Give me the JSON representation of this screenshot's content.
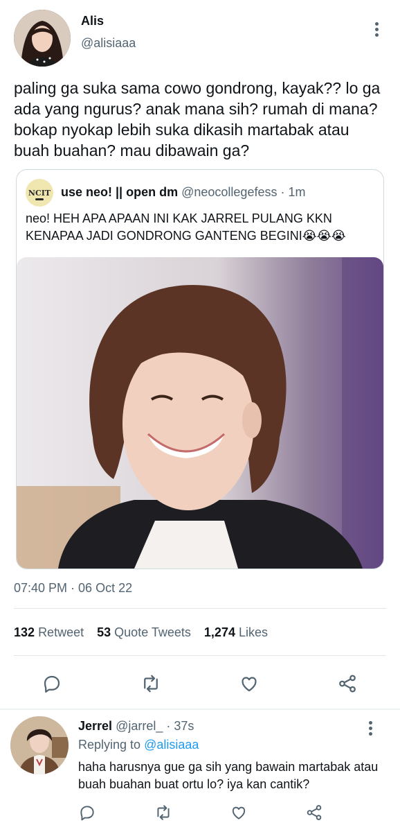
{
  "tweet": {
    "author_name": "Alis",
    "author_handle": "@alisiaaa",
    "text": "paling ga suka sama cowo gondrong, kayak?? lo ga ada yang ngurus? anak mana sih? rumah di mana? bokap nyokap lebih suka dikasih martabak atau buah buahan? mau dibawain ga?",
    "timestamp": "07:40 PM · 06 Oct 22",
    "stats": {
      "retweets_count": "132",
      "retweets_label": "Retweet",
      "quotes_count": "53",
      "quotes_label": "Quote Tweets",
      "likes_count": "1,274",
      "likes_label": "Likes"
    }
  },
  "quote": {
    "avatar_text": "NCIT",
    "name": "use neo! || open dm",
    "handle": "@neocollegefess",
    "separator": "·",
    "time": "1m",
    "text": "neo! HEH APA APAAN INI KAK JARREL PULANG KKN KENAPAA JADI GONDRONG GANTENG BEGINI😭😭😭"
  },
  "reply": {
    "name": "Jerrel",
    "handle": "@jarrel_",
    "separator": "·",
    "time": "37s",
    "replying_prefix": "Replying to",
    "replying_to": "@alisiaaa",
    "text": "haha harusnya gue ga sih yang bawain martabak atau buah buahan buat ortu lo? iya kan cantik?"
  },
  "icons": [
    "more-vertical-icon",
    "reply-icon",
    "retweet-icon",
    "like-icon",
    "share-icon"
  ],
  "colors": {
    "text": "#0f1419",
    "secondary": "#536471",
    "link": "#1d9bf0",
    "border": "#cfd9de"
  }
}
